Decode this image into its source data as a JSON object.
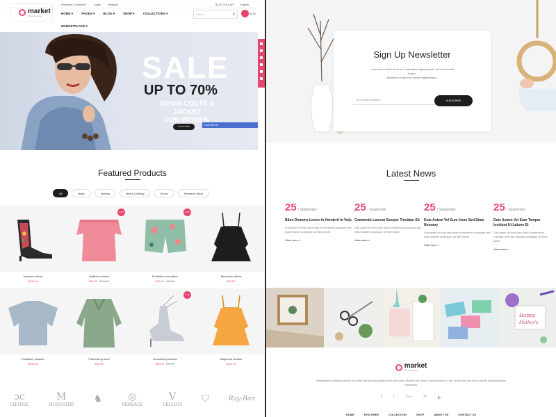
{
  "left": {
    "topbar": {
      "welcome": "Welcome Customer!",
      "login": "Login",
      "register": "Register",
      "currency": "$ US DOLLAR",
      "language": "English"
    },
    "logo": {
      "name": "market",
      "tagline": "all in one store"
    },
    "nav": {
      "items": [
        "HOME ▾",
        "PAGES ▾",
        "BLOG ▾",
        "SHOP ▾",
        "COLLECTIONS ▾"
      ],
      "second_row": "MARKETPLACE ▾"
    },
    "search": {
      "placeholder": "Search"
    },
    "cart": {
      "label": "$0.00"
    },
    "hero": {
      "sale": "SALE",
      "up_to": "UP TO 70%",
      "line1": "DENIM COSTS & JACKET",
      "line2": "FOR WOMEN",
      "button": "SHOP NOW",
      "chat": "Chat with Us"
    },
    "featured": {
      "title": "Featured Products",
      "filters": [
        "All",
        "Bags",
        "Jewelry",
        "Men's Clothing",
        "Shoes",
        "Women's Wear"
      ],
      "products": [
        {
          "name": "Jalapeno dolore",
          "price": "$100.00",
          "old": "",
          "badge": ""
        },
        {
          "name": "Hoffluck chicken",
          "price": "$90.00",
          "old": "$100.00",
          "badge": "-10%"
        },
        {
          "name": "Exhibition cacciatore",
          "price": "$40.00",
          "old": "$45.00",
          "badge": "-11%"
        },
        {
          "name": "Bendenim officia",
          "price": "$39.00",
          "old": "",
          "badge": ""
        },
        {
          "name": "Incididunt picanha",
          "price": "$100.00",
          "old": "",
          "badge": ""
        },
        {
          "name": "Fabricato ground",
          "price": "$92.00",
          "old": "",
          "badge": ""
        },
        {
          "name": "Drumstick pancetta",
          "price": "$50.00",
          "old": "$60.00",
          "badge": "-17%"
        },
        {
          "name": "Magicrulo incididu",
          "price": "$100.00",
          "old": "",
          "badge": ""
        }
      ]
    },
    "brands": [
      "CHANEL",
      "MOSCHINE",
      "",
      "VERSACE",
      "VELLOCI",
      "",
      "Ray-Ban"
    ]
  },
  "right": {
    "newsletter": {
      "title": "Sign Up Newsletter",
      "text1": "Lorem ipsum dolor sit amet, consectetur adipiscing elit, sed do eiusmod",
      "text2": "tempor",
      "text3": "incididunt ut labore et dolore magna aliqua.",
      "placeholder": "Your email address...",
      "button": "SUBSCRIBE"
    },
    "news": {
      "title": "Latest News",
      "posts": [
        {
          "day": "25",
          "month": "/ September",
          "title": "Biten Demons Lector In Henderit In Vulp",
          "excerpt": "Duis autem vel eum iriure dolor in hendrerit in vulputate velit esse molestie consequat, vel illum dolore",
          "more": "View more »"
        },
        {
          "day": "25",
          "month": "/ September",
          "title": "Commodo Laoreet Semper Tincidun Sit",
          "excerpt": "Duis autem vel eum iriure dolor in hendrerit in vulputate velit esse molestie consequat, vel illum dolore",
          "more": "View more »"
        },
        {
          "day": "25",
          "month": "/ September",
          "title": "Duis Autem Vel Eum Iriure Sed Diam Nonumy",
          "excerpt": "Duis autem vel eum iriure dolor in hendrerit in vulputate velit esse molestie consequat, vel illum dolore",
          "more": "View more »"
        },
        {
          "day": "25",
          "month": "/ September",
          "title": "Duis Autem Vel Eum Tempor Invidunt Ut Labore Et",
          "excerpt": "Duis autem vel eum iriure dolor in hendrerit in vulputate velit esse molestie consequat, vel illum dolore",
          "more": "View more »"
        }
      ]
    },
    "footer": {
      "logo": "market",
      "tagline": "all in one store",
      "text": "Webmarket business concept is to offer fashion and quality at the best price. Market has since it was founded in 1987 grown into one of the world's leading fashion companies.",
      "social": [
        "f",
        "t",
        "G+",
        "P",
        "▶"
      ],
      "nav": [
        "HOME",
        "FEATURES",
        "COLLECTION",
        "SHOP",
        "ABOUT US",
        "CONTACT US"
      ]
    }
  },
  "colors": {
    "accent": "#e8466e",
    "dark": "#1d1d1d"
  }
}
